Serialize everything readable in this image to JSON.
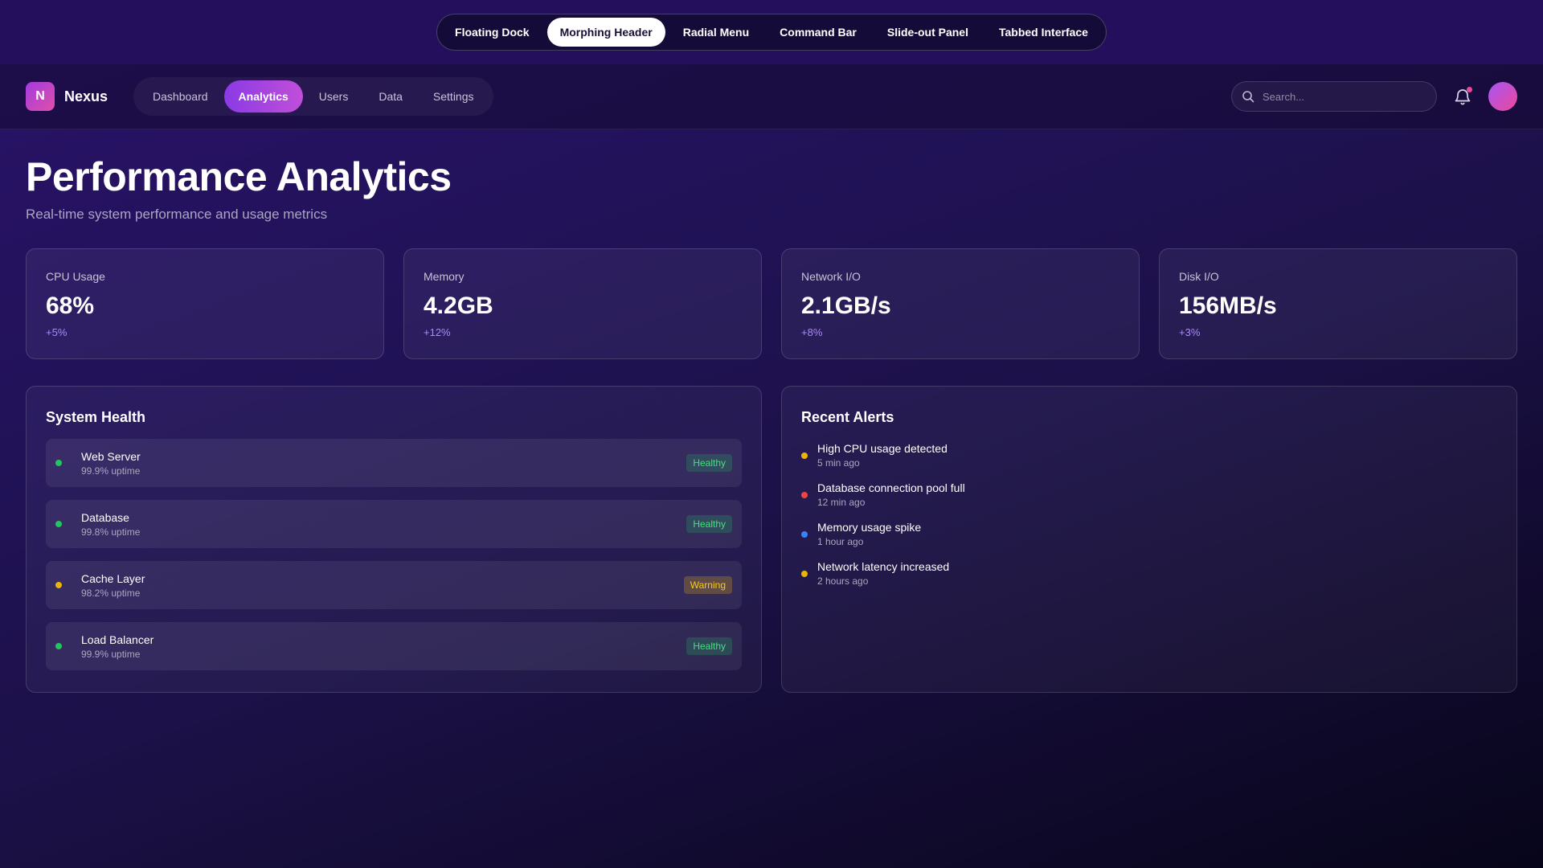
{
  "switcher": {
    "items": [
      {
        "label": "Floating Dock"
      },
      {
        "label": "Morphing Header"
      },
      {
        "label": "Radial Menu"
      },
      {
        "label": "Command Bar"
      },
      {
        "label": "Slide-out Panel"
      },
      {
        "label": "Tabbed Interface"
      }
    ],
    "active": "Morphing Header"
  },
  "header": {
    "logo_letter": "N",
    "brand": "Nexus",
    "nav": [
      {
        "label": "Dashboard"
      },
      {
        "label": "Analytics"
      },
      {
        "label": "Users"
      },
      {
        "label": "Data"
      },
      {
        "label": "Settings"
      }
    ],
    "active_nav": "Analytics",
    "search_placeholder": "Search...",
    "icons": {
      "search": "search-icon",
      "bell": "bell-icon"
    }
  },
  "page": {
    "title": "Performance Analytics",
    "subtitle": "Real-time system performance and usage metrics"
  },
  "metrics": [
    {
      "label": "CPU Usage",
      "value": "68%",
      "change": "+5%"
    },
    {
      "label": "Memory",
      "value": "4.2GB",
      "change": "+12%"
    },
    {
      "label": "Network I/O",
      "value": "2.1GB/s",
      "change": "+8%"
    },
    {
      "label": "Disk I/O",
      "value": "156MB/s",
      "change": "+3%"
    }
  ],
  "system_health": {
    "title": "System Health",
    "items": [
      {
        "name": "Web Server",
        "uptime": "99.9% uptime",
        "status": "Healthy",
        "color": "#22c55e"
      },
      {
        "name": "Database",
        "uptime": "99.8% uptime",
        "status": "Healthy",
        "color": "#22c55e"
      },
      {
        "name": "Cache Layer",
        "uptime": "98.2% uptime",
        "status": "Warning",
        "color": "#eab308"
      },
      {
        "name": "Load Balancer",
        "uptime": "99.9% uptime",
        "status": "Healthy",
        "color": "#22c55e"
      }
    ]
  },
  "recent_alerts": {
    "title": "Recent Alerts",
    "items": [
      {
        "title": "High CPU usage detected",
        "time": "5 min ago",
        "color": "#eab308"
      },
      {
        "title": "Database connection pool full",
        "time": "12 min ago",
        "color": "#ef4444"
      },
      {
        "title": "Memory usage spike",
        "time": "1 hour ago",
        "color": "#3b82f6"
      },
      {
        "title": "Network latency increased",
        "time": "2 hours ago",
        "color": "#eab308"
      }
    ]
  },
  "colors": {
    "accent": "#8b3ae6",
    "healthy": "#22c55e",
    "warning": "#eab308",
    "error": "#ef4444",
    "info": "#3b82f6"
  }
}
